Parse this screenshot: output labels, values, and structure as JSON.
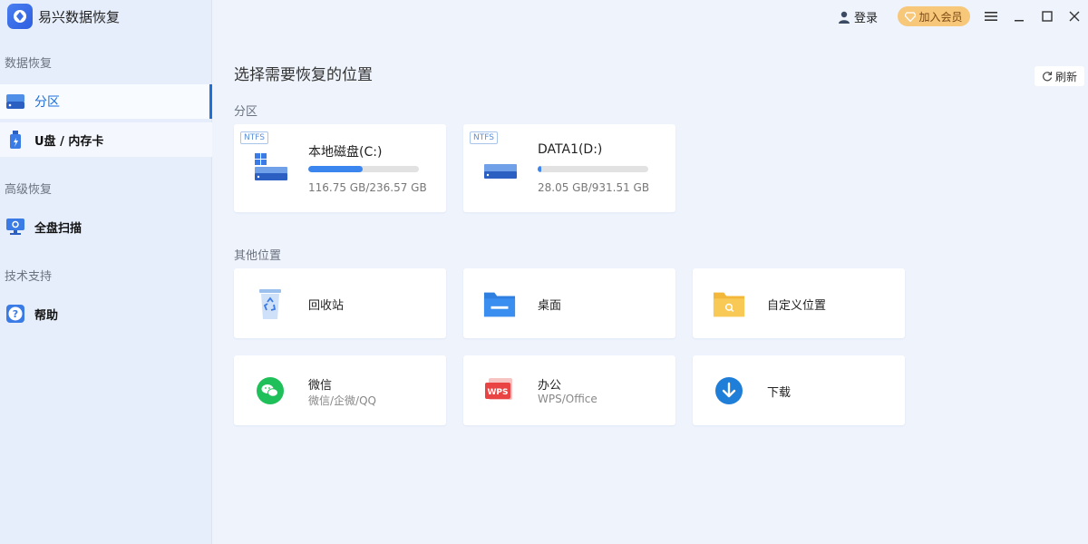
{
  "app": {
    "title": "易兴数据恢复"
  },
  "sidebar": {
    "sections": [
      {
        "label": "数据恢复"
      },
      {
        "label": "高级恢复"
      },
      {
        "label": "技术支持"
      }
    ],
    "items": [
      {
        "label": "分区"
      },
      {
        "label": "U盘 / 内存卡"
      },
      {
        "label": "全盘扫描"
      },
      {
        "label": "帮助"
      }
    ]
  },
  "header": {
    "login_label": "登录",
    "vip_label": "加入会员"
  },
  "main": {
    "title": "选择需要恢复的位置",
    "refresh_label": "刷新",
    "partition_group": "分区",
    "other_group": "其他位置",
    "drives": [
      {
        "fs": "NTFS",
        "name": "本地磁盘(C:)",
        "size": "116.75 GB/236.57 GB",
        "used_fraction": 0.493
      },
      {
        "fs": "NTFS",
        "name": "DATA1(D:)",
        "size": "28.05 GB/931.51 GB",
        "used_fraction": 0.03
      }
    ],
    "locations": [
      {
        "name": "回收站",
        "sub": ""
      },
      {
        "name": "桌面",
        "sub": ""
      },
      {
        "name": "自定义位置",
        "sub": ""
      },
      {
        "name": "微信",
        "sub": "微信/企微/QQ"
      },
      {
        "name": "办公",
        "sub": "WPS/Office"
      },
      {
        "name": "下载",
        "sub": ""
      }
    ],
    "wps_badge": "WPS"
  },
  "colors": {
    "accent": "#1e6fd9",
    "bar": "#3a86ee",
    "vip": "#f7c77a",
    "wechat": "#1fbf5a",
    "download": "#1f7ed8"
  }
}
